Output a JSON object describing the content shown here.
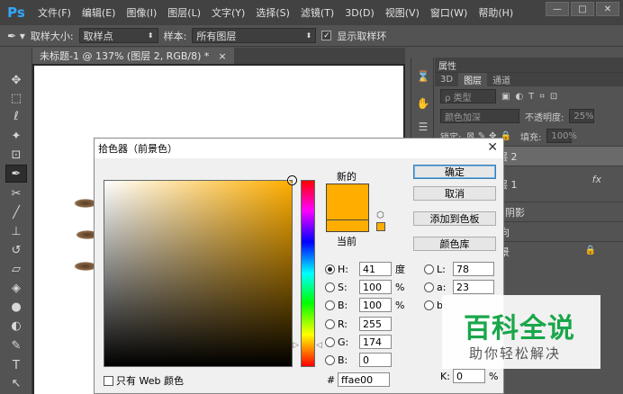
{
  "app": {
    "logo": "Ps"
  },
  "menu": [
    "文件(F)",
    "编辑(E)",
    "图像(I)",
    "图层(L)",
    "文字(Y)",
    "选择(S)",
    "滤镜(T)",
    "3D(D)",
    "视图(V)",
    "窗口(W)",
    "帮助(H)"
  ],
  "window_controls": [
    "—",
    "□",
    "✕"
  ],
  "options": {
    "sample_size_label": "取样大小:",
    "sample_size_value": "取样点",
    "sample_label": "样本:",
    "sample_value": "所有图层",
    "ring_label": "显示取样环",
    "ring_checked": true
  },
  "document_tab": {
    "title": "未标题-1 @ 137% (图层 2, RGB/8) *",
    "close": "×"
  },
  "panels": {
    "properties_title": "属性",
    "tabs": [
      "3D",
      "图层",
      "通道"
    ],
    "active_tab": "图层",
    "filter_label": "ρ 类型",
    "blend_mode": "颜色加深",
    "opacity_label": "不透明度:",
    "opacity_value": "25%",
    "lock_label": "锁定:",
    "fill_label": "填充:",
    "fill_value": "100%",
    "layers": [
      {
        "name": "层 2",
        "selected": true,
        "badge": ""
      },
      {
        "name": "层 1",
        "selected": false,
        "badge": "fx"
      },
      {
        "name": "阴影",
        "selected": false,
        "badge": ""
      },
      {
        "name": "向",
        "selected": false,
        "badge": ""
      },
      {
        "name": "景",
        "selected": false,
        "badge": "🔒"
      }
    ]
  },
  "color_picker": {
    "title": "拾色器（前景色）",
    "new_label": "新的",
    "current_label": "当前",
    "new_color": "#ffae00",
    "current_color": "#ffae00",
    "buttons": {
      "ok": "确定",
      "cancel": "取消",
      "add_swatch": "添加到色板",
      "color_library": "颜色库"
    },
    "hsb": {
      "h": "41",
      "s": "100",
      "b": "100",
      "h_unit": "度",
      "s_unit": "%",
      "b_unit": "%"
    },
    "rgb": {
      "r": "255",
      "g": "174",
      "b": "0"
    },
    "lab": {
      "l": "78",
      "a": "23"
    },
    "k_label": "K:",
    "k_value": "0",
    "k_unit": "%",
    "hex_label": "#",
    "hex": "ffae00",
    "web_only_label": "只有 Web 颜色"
  },
  "watermark": {
    "main": "百科全说",
    "sub": "助你轻松解决"
  },
  "colors": {
    "accent": "#31a8ff",
    "picked": "#ffae00",
    "watermark_green": "#1aa64a"
  }
}
